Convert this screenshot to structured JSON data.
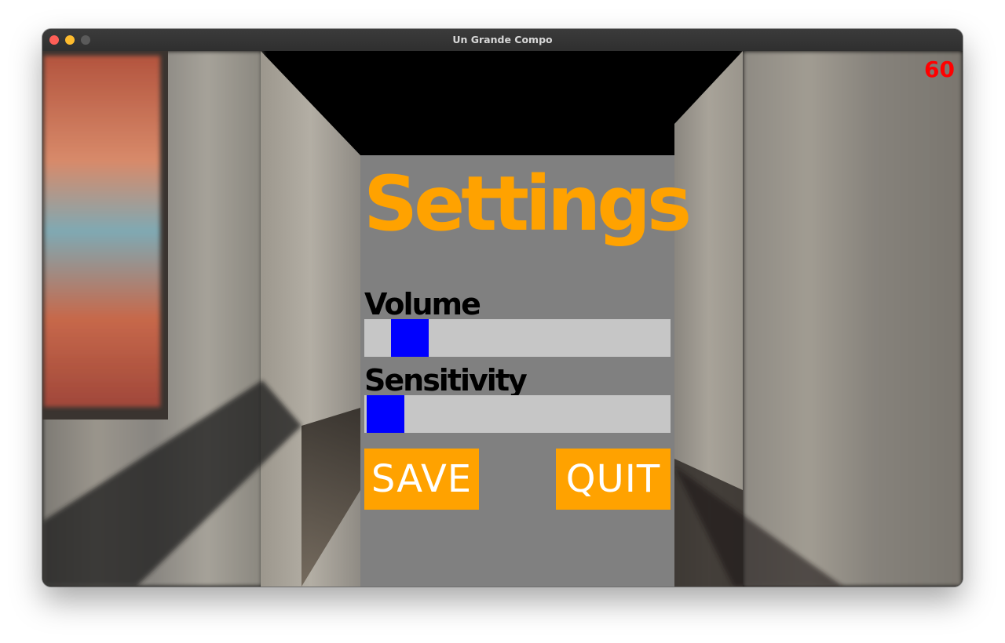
{
  "window": {
    "title": "Un Grande Compo"
  },
  "hud": {
    "fps": "60",
    "fps_color": "#ff0000"
  },
  "settings": {
    "title": "Settings",
    "title_color": "#ffa200",
    "volume": {
      "label": "Volume",
      "level": 0.09
    },
    "sensitivity": {
      "label": "Sensitivity",
      "level": 0.0
    },
    "save_label": "SAVE",
    "quit_label": "QUIT",
    "button_color": "#ffa200",
    "thumb_color": "#0000ff"
  }
}
